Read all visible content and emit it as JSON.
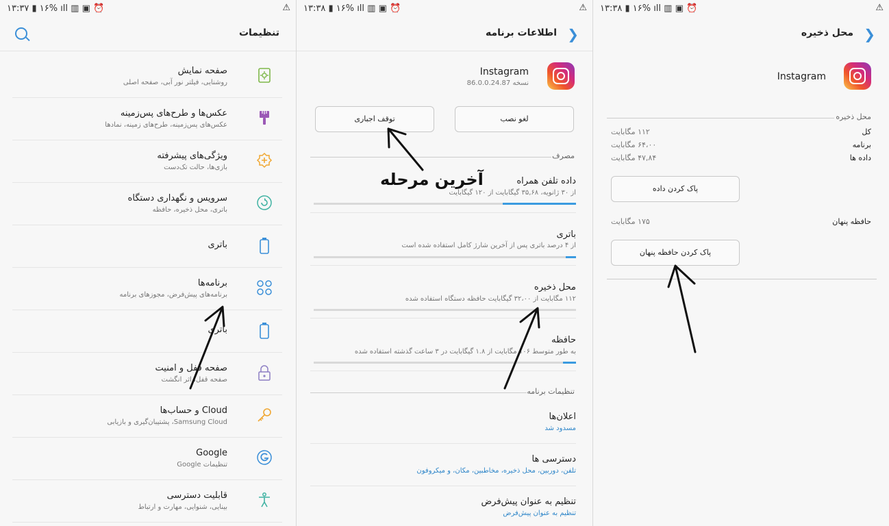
{
  "panel1": {
    "status": {
      "time": "۱۳:۳۷",
      "battery": "۱۶%"
    },
    "title": "تنظیمات",
    "items": [
      {
        "title": "صفحه نمایش",
        "sub": "روشنایی، فیلتر نور آبی، صفحه اصلی",
        "icon": "display-icon"
      },
      {
        "title": "عکس‌ها و طرح‌های پس‌زمینه",
        "sub": "عکس‌های پس‌زمینه، طرح‌های زمینه، نمادها",
        "icon": "paintbrush-icon"
      },
      {
        "title": "ویژگی‌های پیشرفته",
        "sub": "بازی‌ها، حالت تک‌دست",
        "icon": "plus-gear-icon"
      },
      {
        "title": "سرویس و نگهداری دستگاه",
        "sub": "باتری، محل ذخیره، حافظه",
        "icon": "refresh-icon"
      },
      {
        "title": "باتری",
        "sub": "",
        "icon": "battery-icon"
      },
      {
        "title": "برنامه‌ها",
        "sub": "برنامه‌های پیش‌فرض، مجوزهای برنامه",
        "icon": "apps-grid-icon"
      },
      {
        "title": "باتری",
        "sub": "",
        "icon": "battery-icon"
      },
      {
        "title": "صفحه قفل و امنیت",
        "sub": "صفحه قفل، اثر انگشت",
        "icon": "lock-icon"
      },
      {
        "title": "Cloud و حساب‌ها",
        "sub": "Samsung Cloud، پشتیبان‌گیری و بازیابی",
        "icon": "key-icon"
      },
      {
        "title": "Google",
        "sub": "تنظیمات Google",
        "icon": "google-icon"
      },
      {
        "title": "قابلیت دسترسی",
        "sub": "بینایی، شنوایی، مهارت و ارتباط",
        "icon": "accessibility-icon"
      }
    ]
  },
  "panel2": {
    "status": {
      "time": "۱۳:۳۸",
      "battery": "۱۶%"
    },
    "title": "اطلاعات برنامه",
    "app_name": "Instagram",
    "app_version": "نسخه 86.0.0.24.87",
    "uninstall": "لغو نصب",
    "force_stop": "توقف اجباری",
    "usage_section": "مصرف",
    "usage_items": [
      {
        "title": "داده تلفن همراه",
        "sub": "از ۳۰ ژانویه، ۳۵,۶۸ گیگابایت از ۱۲۰ گیگابایت",
        "fill": 0.2
      },
      {
        "title": "باتری",
        "sub": "از ۴ درصد باتری پس از آخرین شارژ کامل استفاده شده است",
        "fill": 0.04
      },
      {
        "title": "محل ذخیره",
        "sub": "۱۱۲ مگابایت از ۳۲،۰۰ گیگابایت حافظه دستگاه استفاده شده",
        "fill": 0.0
      },
      {
        "title": "حافظه",
        "sub": "به طور متوسط ۱۰۶ مگابایت از ۱.۸ گیگابایت در ۳ ساعت گذشته استفاده شده",
        "fill": 0.06
      }
    ],
    "app_settings_section": "تنظیمات برنامه",
    "settings_items": [
      {
        "title": "اعلان‌ها",
        "sub": "مسدود شد"
      },
      {
        "title": "دسترسی ها",
        "sub": "تلفن، دوربین، محل ذخیره، مخاطبین، مکان، و میکروفون"
      },
      {
        "title": "تنظیم به عنوان پیش‌فرض",
        "sub": "تنظیم به عنوان پیش‌فرض"
      }
    ],
    "overlay_text": "آخرین مرحله"
  },
  "panel3": {
    "status": {
      "time": "۱۳:۳۸",
      "battery": "۱۶%"
    },
    "title": "محل ذخیره",
    "app_name": "Instagram",
    "storage_section": "محل ذخیره",
    "rows": [
      {
        "k": "کل",
        "v": "۱۱۲ مگابایت"
      },
      {
        "k": "برنامه",
        "v": "۶۴،۰۰ مگابایت"
      },
      {
        "k": "داده ها",
        "v": "۴۷,۸۴ مگابایت"
      }
    ],
    "clear_data": "پاک کردن داده",
    "cache_label": "حافظه پنهان",
    "cache_value": "۱۷۵ مگابایت",
    "clear_cache": "پاک کردن حافظه پنهان"
  }
}
